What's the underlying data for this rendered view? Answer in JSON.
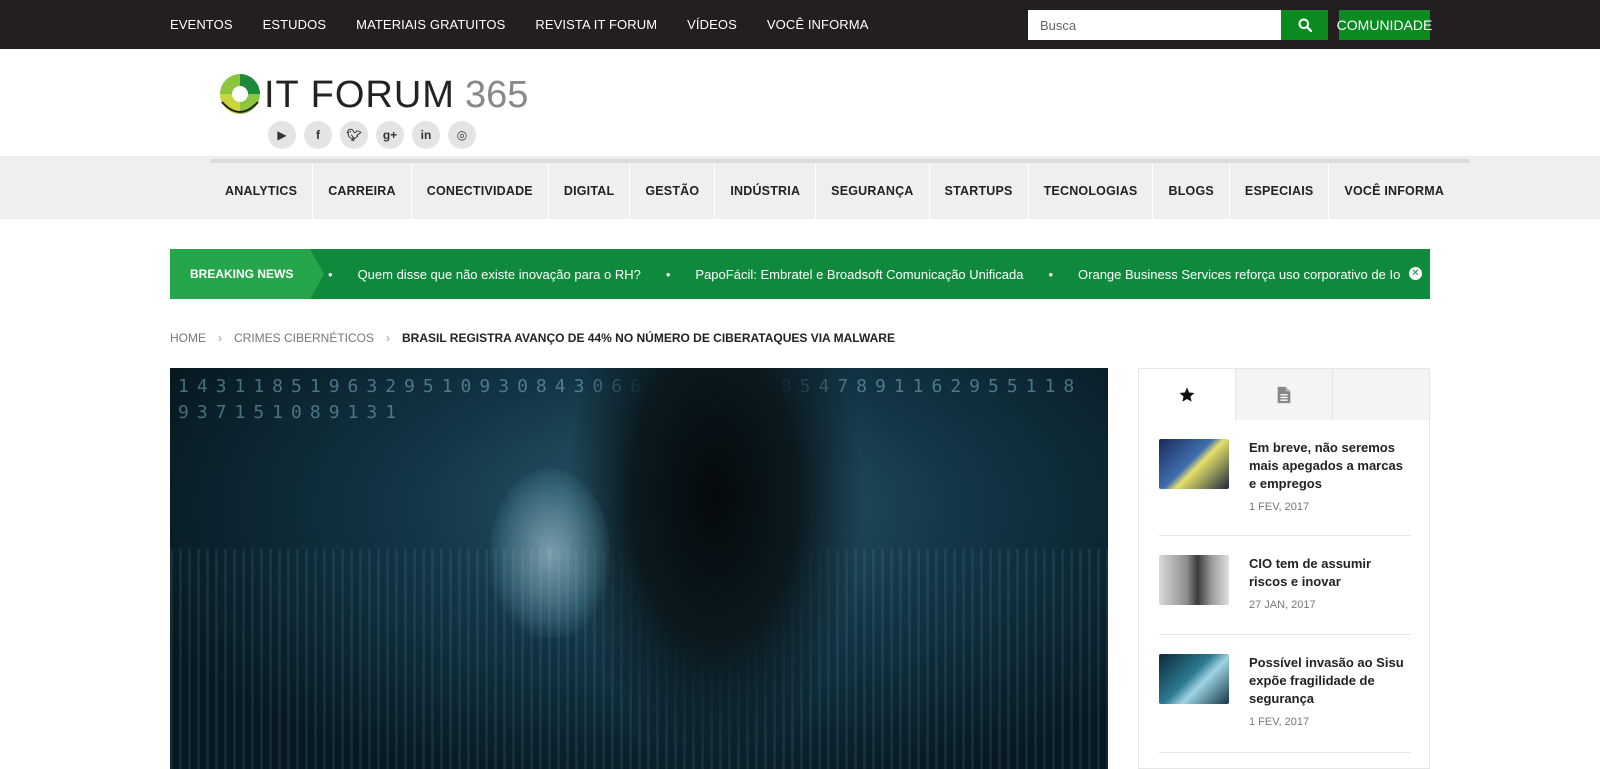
{
  "topnav": {
    "items": [
      "EVENTOS",
      "ESTUDOS",
      "MATERIAIS GRATUITOS",
      "REVISTA IT FORUM",
      "VÍDEOS",
      "VOCÊ INFORMA"
    ],
    "search_placeholder": "Busca",
    "community_label": "COMUNIDADE"
  },
  "logo": {
    "text": "IT FORUM",
    "number": "365"
  },
  "social": [
    "youtube-icon",
    "facebook-icon",
    "twitter-icon",
    "google-plus-icon",
    "linkedin-icon",
    "instagram-icon"
  ],
  "mainnav": {
    "items": [
      "ANALYTICS",
      "CARREIRA",
      "CONECTIVIDADE",
      "DIGITAL",
      "GESTÃO",
      "INDÚSTRIA",
      "SEGURANÇA",
      "STARTUPS",
      "TECNOLOGIAS",
      "BLOGS",
      "ESPECIAIS",
      "VOCÊ INFORMA"
    ]
  },
  "breaking": {
    "label": "BREAKING NEWS",
    "items": [
      "Quem disse que não existe inovação para o RH?",
      "PapoFácil: Embratel e Broadsoft Comunicação Unificada",
      "Orange Business Services reforça uso corporativo de IoT com"
    ]
  },
  "breadcrumb": {
    "home": "HOME",
    "category": "CRIMES CIBERNÉTICOS",
    "current": "BRASIL REGISTRA AVANÇO DE 44% NO NÚMERO DE CIBERATAQUES VIA MALWARE"
  },
  "hero": {
    "digits": "1431185196329510930843066362 6618547891162955118937151089131"
  },
  "sidebar": {
    "tabs": [
      "star-icon",
      "document-icon"
    ],
    "posts": [
      {
        "title": "Em breve, não seremos mais apegados a marcas e empregos",
        "date": "1 FEV, 2017"
      },
      {
        "title": "CIO tem de assumir riscos e inovar",
        "date": "27 JAN, 2017"
      },
      {
        "title": "Possível invasão ao Sisu expõe fragilidade de segurança",
        "date": "1 FEV, 2017"
      }
    ]
  }
}
